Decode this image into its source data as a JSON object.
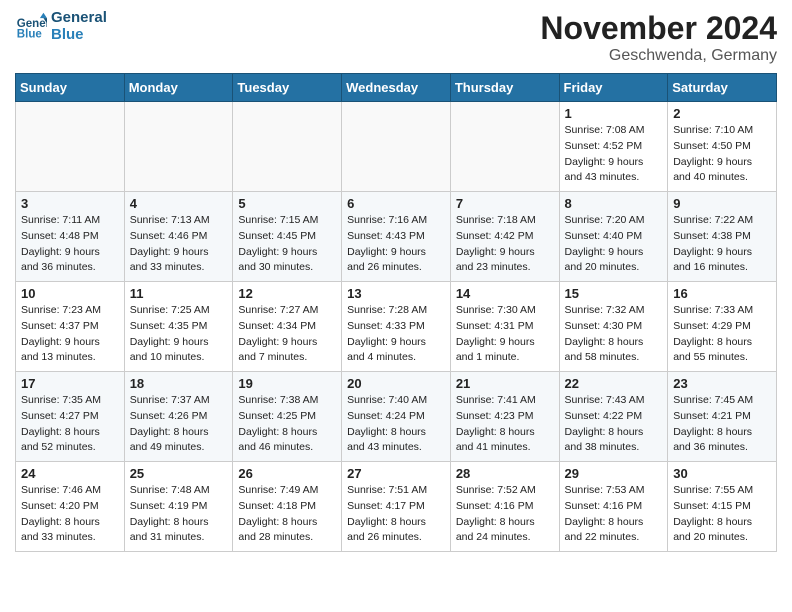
{
  "header": {
    "logo_line1": "General",
    "logo_line2": "Blue",
    "month": "November 2024",
    "location": "Geschwenda, Germany"
  },
  "weekdays": [
    "Sunday",
    "Monday",
    "Tuesday",
    "Wednesday",
    "Thursday",
    "Friday",
    "Saturday"
  ],
  "weeks": [
    [
      {
        "day": "",
        "info": ""
      },
      {
        "day": "",
        "info": ""
      },
      {
        "day": "",
        "info": ""
      },
      {
        "day": "",
        "info": ""
      },
      {
        "day": "",
        "info": ""
      },
      {
        "day": "1",
        "info": "Sunrise: 7:08 AM\nSunset: 4:52 PM\nDaylight: 9 hours\nand 43 minutes."
      },
      {
        "day": "2",
        "info": "Sunrise: 7:10 AM\nSunset: 4:50 PM\nDaylight: 9 hours\nand 40 minutes."
      }
    ],
    [
      {
        "day": "3",
        "info": "Sunrise: 7:11 AM\nSunset: 4:48 PM\nDaylight: 9 hours\nand 36 minutes."
      },
      {
        "day": "4",
        "info": "Sunrise: 7:13 AM\nSunset: 4:46 PM\nDaylight: 9 hours\nand 33 minutes."
      },
      {
        "day": "5",
        "info": "Sunrise: 7:15 AM\nSunset: 4:45 PM\nDaylight: 9 hours\nand 30 minutes."
      },
      {
        "day": "6",
        "info": "Sunrise: 7:16 AM\nSunset: 4:43 PM\nDaylight: 9 hours\nand 26 minutes."
      },
      {
        "day": "7",
        "info": "Sunrise: 7:18 AM\nSunset: 4:42 PM\nDaylight: 9 hours\nand 23 minutes."
      },
      {
        "day": "8",
        "info": "Sunrise: 7:20 AM\nSunset: 4:40 PM\nDaylight: 9 hours\nand 20 minutes."
      },
      {
        "day": "9",
        "info": "Sunrise: 7:22 AM\nSunset: 4:38 PM\nDaylight: 9 hours\nand 16 minutes."
      }
    ],
    [
      {
        "day": "10",
        "info": "Sunrise: 7:23 AM\nSunset: 4:37 PM\nDaylight: 9 hours\nand 13 minutes."
      },
      {
        "day": "11",
        "info": "Sunrise: 7:25 AM\nSunset: 4:35 PM\nDaylight: 9 hours\nand 10 minutes."
      },
      {
        "day": "12",
        "info": "Sunrise: 7:27 AM\nSunset: 4:34 PM\nDaylight: 9 hours\nand 7 minutes."
      },
      {
        "day": "13",
        "info": "Sunrise: 7:28 AM\nSunset: 4:33 PM\nDaylight: 9 hours\nand 4 minutes."
      },
      {
        "day": "14",
        "info": "Sunrise: 7:30 AM\nSunset: 4:31 PM\nDaylight: 9 hours\nand 1 minute."
      },
      {
        "day": "15",
        "info": "Sunrise: 7:32 AM\nSunset: 4:30 PM\nDaylight: 8 hours\nand 58 minutes."
      },
      {
        "day": "16",
        "info": "Sunrise: 7:33 AM\nSunset: 4:29 PM\nDaylight: 8 hours\nand 55 minutes."
      }
    ],
    [
      {
        "day": "17",
        "info": "Sunrise: 7:35 AM\nSunset: 4:27 PM\nDaylight: 8 hours\nand 52 minutes."
      },
      {
        "day": "18",
        "info": "Sunrise: 7:37 AM\nSunset: 4:26 PM\nDaylight: 8 hours\nand 49 minutes."
      },
      {
        "day": "19",
        "info": "Sunrise: 7:38 AM\nSunset: 4:25 PM\nDaylight: 8 hours\nand 46 minutes."
      },
      {
        "day": "20",
        "info": "Sunrise: 7:40 AM\nSunset: 4:24 PM\nDaylight: 8 hours\nand 43 minutes."
      },
      {
        "day": "21",
        "info": "Sunrise: 7:41 AM\nSunset: 4:23 PM\nDaylight: 8 hours\nand 41 minutes."
      },
      {
        "day": "22",
        "info": "Sunrise: 7:43 AM\nSunset: 4:22 PM\nDaylight: 8 hours\nand 38 minutes."
      },
      {
        "day": "23",
        "info": "Sunrise: 7:45 AM\nSunset: 4:21 PM\nDaylight: 8 hours\nand 36 minutes."
      }
    ],
    [
      {
        "day": "24",
        "info": "Sunrise: 7:46 AM\nSunset: 4:20 PM\nDaylight: 8 hours\nand 33 minutes."
      },
      {
        "day": "25",
        "info": "Sunrise: 7:48 AM\nSunset: 4:19 PM\nDaylight: 8 hours\nand 31 minutes."
      },
      {
        "day": "26",
        "info": "Sunrise: 7:49 AM\nSunset: 4:18 PM\nDaylight: 8 hours\nand 28 minutes."
      },
      {
        "day": "27",
        "info": "Sunrise: 7:51 AM\nSunset: 4:17 PM\nDaylight: 8 hours\nand 26 minutes."
      },
      {
        "day": "28",
        "info": "Sunrise: 7:52 AM\nSunset: 4:16 PM\nDaylight: 8 hours\nand 24 minutes."
      },
      {
        "day": "29",
        "info": "Sunrise: 7:53 AM\nSunset: 4:16 PM\nDaylight: 8 hours\nand 22 minutes."
      },
      {
        "day": "30",
        "info": "Sunrise: 7:55 AM\nSunset: 4:15 PM\nDaylight: 8 hours\nand 20 minutes."
      }
    ]
  ]
}
